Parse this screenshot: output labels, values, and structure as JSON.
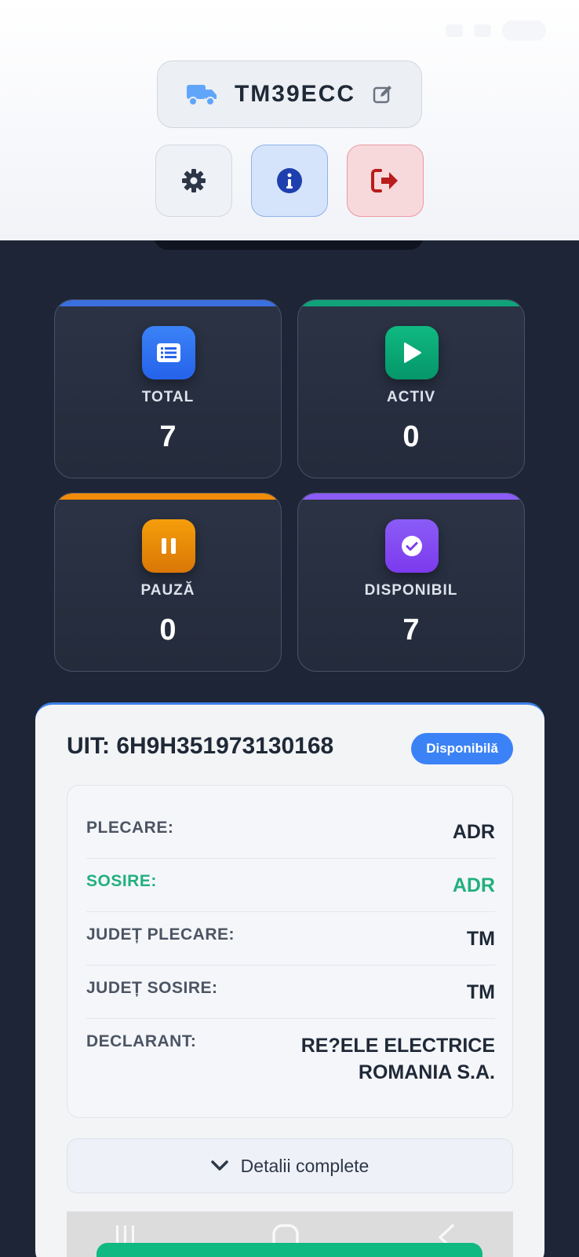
{
  "header": {
    "vehicle_plate": "TM39ECC",
    "buttons": [
      "settings",
      "info",
      "logout"
    ]
  },
  "stats": [
    {
      "label": "TOTAL",
      "value": "7",
      "color": "#3b6fe0",
      "icon": "list-icon"
    },
    {
      "label": "ACTIV",
      "value": "0",
      "color": "#10a37a",
      "icon": "play-icon"
    },
    {
      "label": "PAUZĂ",
      "value": "0",
      "color": "#f08c0a",
      "icon": "pause-icon"
    },
    {
      "label": "DISPONIBIL",
      "value": "7",
      "color": "#8b5cf6",
      "icon": "check-circle-icon"
    }
  ],
  "transport": {
    "uit": "UIT: 6H9H351973130168",
    "status": "Disponibilă",
    "rows": [
      {
        "label": "PLECARE:",
        "value": "ADR"
      },
      {
        "label": "SOSIRE:",
        "value": "ADR"
      },
      {
        "label": "JUDEȚ PLECARE:",
        "value": "TM"
      },
      {
        "label": "JUDEȚ SOSIRE:",
        "value": "TM"
      },
      {
        "label": "DECLARANT:",
        "value": "RE?ELE ELECTRICE ROMANIA S.A."
      }
    ],
    "details_label": "Detalii complete"
  },
  "colors": {
    "accent_blue": "#3b82f6",
    "success_green": "#22b07d",
    "background_dark": "#1e2536"
  }
}
